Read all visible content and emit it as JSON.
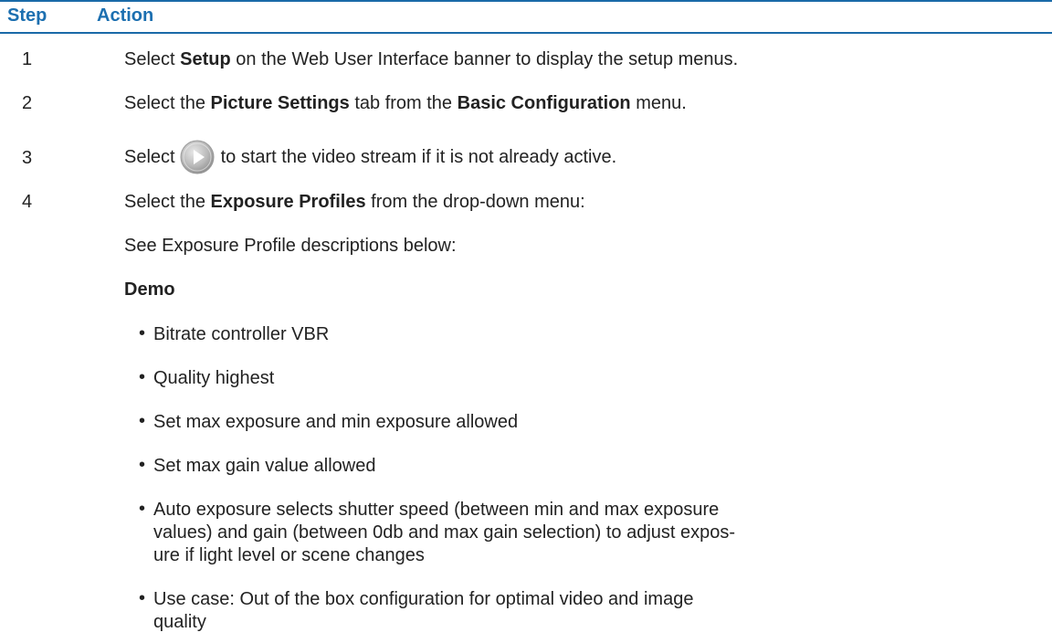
{
  "table": {
    "header": {
      "step": "Step",
      "action": "Action"
    },
    "rows": [
      {
        "num": "1",
        "pre": "Select ",
        "bold1": "Setup",
        "post": " on the Web User Interface banner to display the setup menus."
      },
      {
        "num": "2",
        "pre": "Select the ",
        "bold1": "Picture Settings",
        "mid": " tab from the ",
        "bold2": "Basic Configuration",
        "post": " menu."
      },
      {
        "num": "3",
        "pre": "Select",
        "icon": "play-button-icon",
        "post": "to start the video stream if it is not already active."
      },
      {
        "num": "4",
        "pre": "Select the ",
        "bold1": "Exposure Profiles",
        "post": " from the drop-down menu:"
      }
    ],
    "see_text": "See Exposure Profile descriptions below:",
    "profile": {
      "name": "Demo",
      "bullets": [
        "Bitrate controller VBR",
        "Quality highest",
        "Set max exposure and min exposure allowed",
        "Set max gain value allowed",
        "Auto exposure selects shutter speed (between min and max exposure values) and gain (between 0db and max gain selection) to adjust expos-ure if light level or scene changes",
        "Use case: Out of the box configuration for optimal video and image quality"
      ]
    }
  }
}
